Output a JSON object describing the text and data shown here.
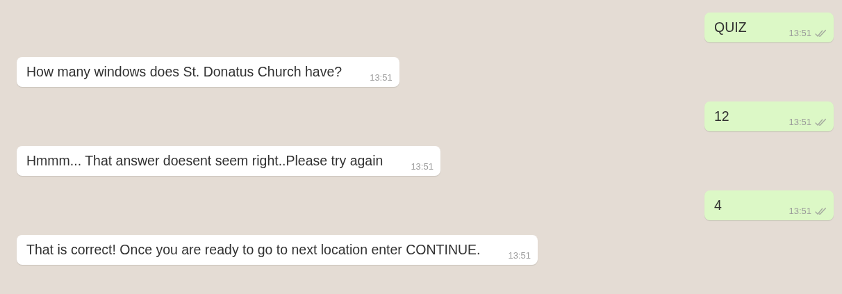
{
  "messages": [
    {
      "outgoing": true,
      "text": "QUIZ",
      "time": "13:51",
      "read": false
    },
    {
      "outgoing": false,
      "text": "How many windows does St. Donatus Church have?",
      "time": "13:51"
    },
    {
      "outgoing": true,
      "text": "12",
      "time": "13:51",
      "read": false
    },
    {
      "outgoing": false,
      "text": "Hmmm... That answer doesent seem right..Please try again",
      "time": "13:51"
    },
    {
      "outgoing": true,
      "text": "4",
      "time": "13:51",
      "read": false
    },
    {
      "outgoing": false,
      "text": "That is correct! Once you are ready to go to next location enter CONTINUE.",
      "time": "13:51"
    }
  ]
}
